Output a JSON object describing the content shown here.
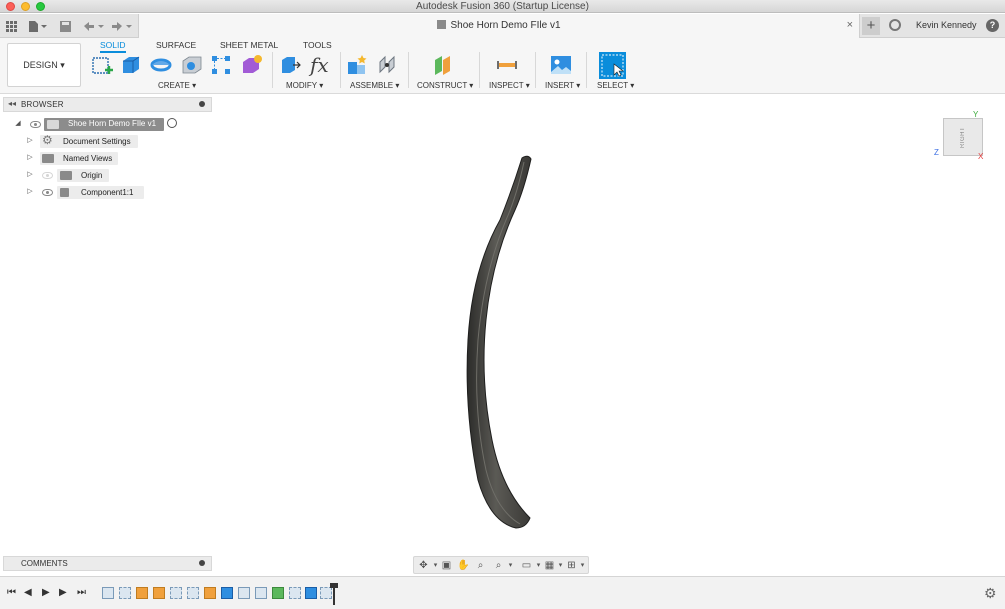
{
  "window": {
    "title": "Autodesk Fusion 360 (Startup License)"
  },
  "tabbar": {
    "document_title": "Shoe Horn Demo FIle v1",
    "close_glyph": "×",
    "new_tab_glyph": "+",
    "user_name": "Kevin Kennedy",
    "help_glyph": "?"
  },
  "toolbar": {
    "workspace_button": "DESIGN",
    "tabs": [
      "SOLID",
      "SURFACE",
      "SHEET METAL",
      "TOOLS"
    ],
    "active_tab": "SOLID",
    "groups": {
      "create": "CREATE",
      "modify": "MODIFY",
      "assemble": "ASSEMBLE",
      "construct": "CONSTRUCT",
      "inspect": "INSPECT",
      "insert": "INSERT",
      "select": "SELECT"
    },
    "accent_color": "#0a8ddb",
    "fx_label": "fx"
  },
  "browser": {
    "title": "BROWSER",
    "root": "Shoe Horn Demo FIle v1",
    "items": [
      {
        "label": "Document Settings",
        "icon": "gear-icon"
      },
      {
        "label": "Named Views",
        "icon": "folder-icon"
      },
      {
        "label": "Origin",
        "icon": "folder-icon"
      },
      {
        "label": "Component1:1",
        "icon": "component-icon"
      }
    ]
  },
  "viewcube": {
    "face": "RIGHT",
    "axis_x": "X",
    "axis_y": "Y",
    "axis_z": "Z",
    "axis_colors": {
      "x": "#e33c3c",
      "y": "#3caa3c",
      "z": "#3c6fe3"
    }
  },
  "comments": {
    "title": "COMMENTS"
  }
}
